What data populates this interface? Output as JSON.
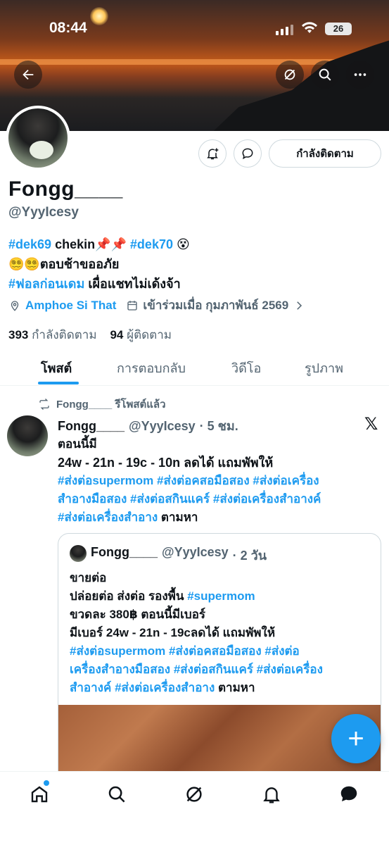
{
  "status_bar": {
    "time": "08:44",
    "battery": "26"
  },
  "profile": {
    "name": "Fongg____",
    "handle": "@YyyIcesy",
    "following_button": "กำลังติดตาม",
    "bio_line1_tag1": "#dek69",
    "bio_line1_text": " chekin📌📌 ",
    "bio_line1_tag2": "#dek70",
    "bio_line1_emoji": " 😵",
    "bio_line2": "😵‍💫😵‍💫ตอบช้าขออภัย",
    "bio_line3_tag": "#ฟอลก่อนเดม",
    "bio_line3_text": " เผื่อแชทไม่เด้งจ้า",
    "location": "Amphoe Si That",
    "joined": "เข้าร่วมเมื่อ กุมภาพันธ์ 2569",
    "following_count": "393",
    "following_label": "กำลังติดตาม",
    "followers_count": "94",
    "followers_label": "ผู้ติดตาม"
  },
  "tabs": [
    {
      "label": "โพสต์",
      "active": true
    },
    {
      "label": "การตอบกลับ",
      "active": false
    },
    {
      "label": "วิดีโอ",
      "active": false
    },
    {
      "label": "รูปภาพ",
      "active": false
    }
  ],
  "post": {
    "repost_label": "Fongg____ รีโพสต์แล้ว",
    "author": "Fongg____",
    "handle": "@YyyIcesy",
    "time": "· 5 ชม.",
    "line1": "ตอนนี้มี",
    "line2": "24w - 21n - 19c - 10n ลดได้ แถมพัพให้",
    "tags_a": " #ส่งต่อsupermom #ส่งต่อคสอมือสอง #ส่งต่อเครื่อง",
    "tags_b": "สำอางมือสอง #ส่งต่อสกินแคร์ #ส่งต่อเครื่องสำอางค์",
    "tags_c": "#ส่งต่อเครื่องสำอาง",
    "tail": " ตามหา"
  },
  "quote": {
    "author": "Fongg____",
    "handle": "@YyyIcesy",
    "time": "· 2 วัน",
    "line1": "ขายต่อ",
    "line2_text": "ปล่อยต่อ ส่งต่อ รองพื้น ",
    "line2_tag": "#supermom",
    "line3": "ขวดละ 380฿ ตอนนี้มีเบอร์",
    "line4": "มีเบอร์ 24w - 21n - 19cลดได้ แถมพัพให้",
    "tags_a": " #ส่งต่อsupermom #ส่งต่อคสอมือสอง #ส่งต่อ",
    "tags_b": "เครื่องสำอางมือสอง #ส่งต่อสกินแคร์ #ส่งต่อเครื่อง",
    "tags_c": "สำอางค์ #ส่งต่อเครื่องสำอาง",
    "tail": " ตามหา"
  },
  "fab_label": "+",
  "colors": {
    "accent": "#1d9bf0",
    "text": "#0f1419",
    "muted": "#536471"
  }
}
